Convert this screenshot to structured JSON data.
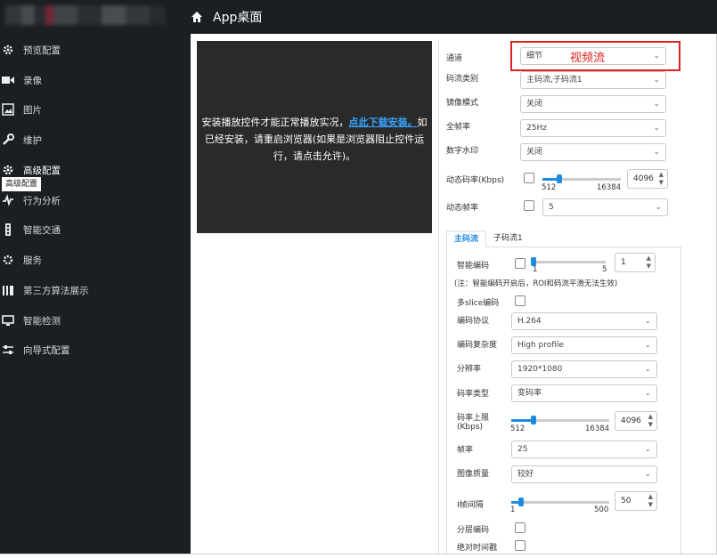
{
  "header": {
    "title": "App桌面"
  },
  "sidebar": {
    "items": [
      {
        "label": "预览配置",
        "icon": "gear-icon"
      },
      {
        "label": "录像",
        "icon": "video-camera-icon"
      },
      {
        "label": "图片",
        "icon": "image-icon"
      },
      {
        "label": "维护",
        "icon": "wrench-icon"
      },
      {
        "label": "高级配置",
        "icon": "gear-icon"
      },
      {
        "label": "行为分析",
        "icon": "activity-icon"
      },
      {
        "label": "智能交通",
        "icon": "traffic-light-icon"
      },
      {
        "label": "服务",
        "icon": "gear-icon"
      },
      {
        "label": "第三方算法展示",
        "icon": "bars-icon"
      },
      {
        "label": "智能检测",
        "icon": "monitor-icon"
      },
      {
        "label": "向导式配置",
        "icon": "sliders-icon"
      }
    ],
    "tooltip": "高级配置"
  },
  "video": {
    "message_before": "安装播放控件才能正常播放实况，",
    "link": "点此下载安装。",
    "message_after": "如已经安装，请重启浏览器(如果是浏览器阻止控件运行，请点击允许)。"
  },
  "annotation": {
    "label": "视频流"
  },
  "form": {
    "channel": {
      "label": "通道",
      "value": "细节"
    },
    "stream_type": {
      "label": "码流类别",
      "value": "主码流,子码流1"
    },
    "mirror": {
      "label": "镜像模式",
      "value": "关闭"
    },
    "frame_rate": {
      "label": "全帧率",
      "value": "25Hz"
    },
    "watermark": {
      "label": "数字水印",
      "value": "关闭"
    },
    "dynamic_bitrate": {
      "label": "动态码率(Kbps)",
      "min": "512",
      "max": "16384",
      "value": "4096"
    },
    "dynamic_framerate": {
      "label": "动态帧率",
      "value": "5"
    }
  },
  "tabs": [
    {
      "label": "主码流"
    },
    {
      "label": "子码流1"
    }
  ],
  "stream": {
    "smart_encode": {
      "label": "智能编码",
      "min": "1",
      "max": "5",
      "value": "1"
    },
    "note": "(注：智能编码开启后，ROI和码流平滑无法生效)",
    "multislice": {
      "label": "多slice编码"
    },
    "protocol": {
      "label": "编码协议",
      "value": "H.264"
    },
    "complexity": {
      "label": "编码复杂度",
      "value": "High profile"
    },
    "resolution": {
      "label": "分辨率",
      "value": "1920*1080"
    },
    "bitrate_type": {
      "label": "码率类型",
      "value": "变码率"
    },
    "bitrate_limit": {
      "label_line1": "码率上限",
      "label_line2": "(Kbps)",
      "min": "512",
      "max": "16384",
      "value": "4096"
    },
    "fps": {
      "label": "帧率",
      "value": "25"
    },
    "quality": {
      "label": "图像质量",
      "value": "较好"
    },
    "iframe": {
      "label": "I帧间隔",
      "min": "1",
      "max": "500",
      "value": "50"
    },
    "layered": {
      "label": "分层编码"
    },
    "abs_time": {
      "label": "绝对时间戳"
    }
  }
}
